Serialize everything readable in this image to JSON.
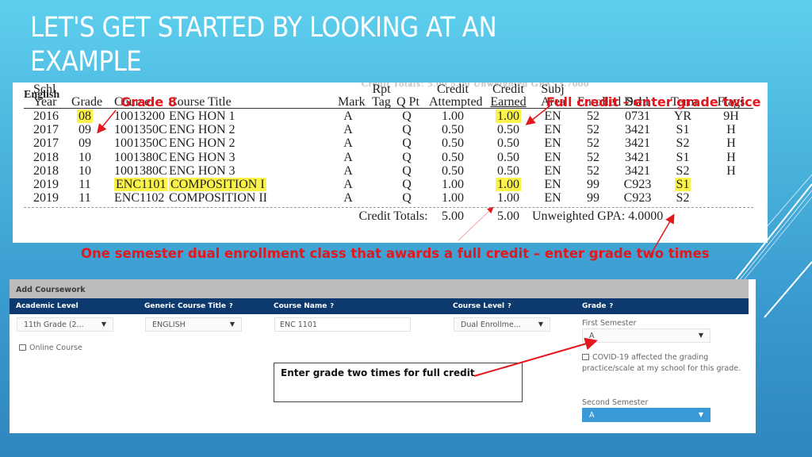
{
  "slide": {
    "title_line1": "LET'S GET STARTED BY LOOKING AT AN",
    "title_line2": "EXAMPLE"
  },
  "transcript": {
    "section": "English",
    "columns": [
      {
        "key": "schl_year",
        "line1": "Schl",
        "line2": "Year"
      },
      {
        "key": "grade",
        "line1": "",
        "line2": "Grade"
      },
      {
        "key": "course",
        "line1": "",
        "line2": "Course"
      },
      {
        "key": "title",
        "line1": "",
        "line2": "Course Title"
      },
      {
        "key": "mark",
        "line1": "",
        "line2": "Mark"
      },
      {
        "key": "rpt_tag",
        "line1": "Rpt",
        "line2": "Tag"
      },
      {
        "key": "q_pt",
        "line1": "",
        "line2": "Q Pt"
      },
      {
        "key": "credit_attempted",
        "line1": "Credit",
        "line2": "Attempted"
      },
      {
        "key": "credit_earned",
        "line1": "Credit",
        "line2": "Earned"
      },
      {
        "key": "subj_area",
        "line1": "Subj",
        "line2": "Area"
      },
      {
        "key": "enrolled_dst",
        "line1": "",
        "line2": "Enrolled Dst"
      },
      {
        "key": "schl",
        "line1": "",
        "line2": "Schl"
      },
      {
        "key": "term",
        "line1": "",
        "line2": "Term"
      },
      {
        "key": "flags",
        "line1": "",
        "line2": "Flags"
      }
    ],
    "rows": [
      {
        "schl_year": "2016",
        "grade": "08",
        "course": "10013200",
        "title": "ENG HON 1",
        "mark": "A",
        "rpt_tag": "",
        "q_pt": "Q",
        "credit_attempted": "1.00",
        "credit_earned": "1.00",
        "subj_area": "EN",
        "enrolled_dst": "52",
        "schl": "0731",
        "term": "YR",
        "flags": "9H"
      },
      {
        "schl_year": "2017",
        "grade": "09",
        "course": "1001350C",
        "title": "ENG HON 2",
        "mark": "A",
        "rpt_tag": "",
        "q_pt": "Q",
        "credit_attempted": "0.50",
        "credit_earned": "0.50",
        "subj_area": "EN",
        "enrolled_dst": "52",
        "schl": "3421",
        "term": "S1",
        "flags": "H"
      },
      {
        "schl_year": "2017",
        "grade": "09",
        "course": "1001350C",
        "title": "ENG HON 2",
        "mark": "A",
        "rpt_tag": "",
        "q_pt": "Q",
        "credit_attempted": "0.50",
        "credit_earned": "0.50",
        "subj_area": "EN",
        "enrolled_dst": "52",
        "schl": "3421",
        "term": "S2",
        "flags": "H"
      },
      {
        "schl_year": "2018",
        "grade": "10",
        "course": "1001380C",
        "title": "ENG HON 3",
        "mark": "A",
        "rpt_tag": "",
        "q_pt": "Q",
        "credit_attempted": "0.50",
        "credit_earned": "0.50",
        "subj_area": "EN",
        "enrolled_dst": "52",
        "schl": "3421",
        "term": "S1",
        "flags": "H"
      },
      {
        "schl_year": "2018",
        "grade": "10",
        "course": "1001380C",
        "title": "ENG HON 3",
        "mark": "A",
        "rpt_tag": "",
        "q_pt": "Q",
        "credit_attempted": "0.50",
        "credit_earned": "0.50",
        "subj_area": "EN",
        "enrolled_dst": "52",
        "schl": "3421",
        "term": "S2",
        "flags": "H"
      },
      {
        "schl_year": "2019",
        "grade": "11",
        "course": "ENC1101",
        "title": "COMPOSITION I",
        "mark": "A",
        "rpt_tag": "",
        "q_pt": "Q",
        "credit_attempted": "1.00",
        "credit_earned": "1.00",
        "subj_area": "EN",
        "enrolled_dst": "99",
        "schl": "C923",
        "term": "S1",
        "flags": ""
      },
      {
        "schl_year": "2019",
        "grade": "11",
        "course": "ENC1102",
        "title": "COMPOSITION II",
        "mark": "A",
        "rpt_tag": "",
        "q_pt": "Q",
        "credit_attempted": "1.00",
        "credit_earned": "1.00",
        "subj_area": "EN",
        "enrolled_dst": "99",
        "schl": "C923",
        "term": "S2",
        "flags": ""
      }
    ],
    "totals": {
      "label": "Credit Totals:",
      "attempted": "5.00",
      "earned": "5.00",
      "gpa_label": "Unweighted GPA:",
      "gpa": "4.0000"
    },
    "ghost_header": "Credit Totals:      5.00          5.00     Unweighted GPA: 3.7000"
  },
  "annotations": {
    "grade8": "Grade 8",
    "full_credit": "Full credit – enter grade twice",
    "dual_enrollment": "One semester dual enrollment class that awards a full credit – enter grade two times",
    "note_box": "Enter grade two times for full credit",
    "color": "#e3171e",
    "highlight_color": "#fbf34a"
  },
  "form": {
    "title": "Add Coursework",
    "headers": {
      "academic_level": "Academic Level",
      "generic_course_title": "Generic Course Title",
      "course_name": "Course Name",
      "course_level": "Course Level",
      "grade": "Grade",
      "help_glyph": "?"
    },
    "academic_level_value": "11th Grade (2...",
    "generic_course_title_value": "ENGLISH",
    "course_name_value": "ENC 1101",
    "course_level_value": "Dual Enrollme...",
    "online_course_label": "Online Course",
    "first_semester_label": "First Semester",
    "first_semester_value": "A",
    "covid_label": "COVID-19 affected the grading practice/scale at my school for this grade.",
    "second_semester_label": "Second Semester",
    "second_semester_value": "A",
    "dropdown_glyph": "▼",
    "header_color": "#0d3a6e",
    "titlebar_color": "#bdbbbb",
    "active_select_color": "#3a9ad8"
  }
}
